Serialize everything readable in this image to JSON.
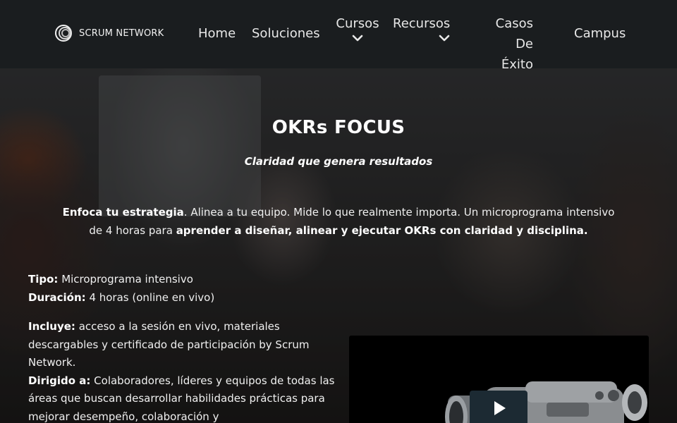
{
  "header": {
    "logo_text": "SCRUM NETWORK",
    "nav": {
      "home": "Home",
      "soluciones": "Soluciones",
      "cursos": "Cursos",
      "recursos": "Recursos",
      "casos_line1": "Casos De",
      "casos_line2": "Éxito",
      "campus": "Campus"
    }
  },
  "hero": {
    "title": "OKRs FOCUS",
    "subtitle": "Claridad que genera resultados",
    "intro": {
      "bold1": "Enfoca tu estrategia",
      "text1": ". Alinea a tu equipo. Mide lo que realmente importa. Un microprograma intensivo de 4 horas para ",
      "bold2": "aprender a diseñar, alinear y ejecutar OKRs con claridad y disciplina."
    }
  },
  "details": {
    "tipo_label": "Tipo:",
    "tipo_value": " Microprograma intensivo",
    "duracion_label": "Duración:",
    "duracion_value": " 4 horas (online en vivo)",
    "incluye_label": "Incluye:",
    "incluye_value": " acceso a la sesión en vivo, materiales descargables y certificado de participación by Scrum Network.",
    "dirigido_label": "Dirigido a:",
    "dirigido_value": " Colaboradores, líderes y equipos de todas las áreas que buscan desarrollar habilidades prácticas para mejorar desempeño, colaboración y"
  },
  "video": {
    "play_icon": "play-icon"
  },
  "colors": {
    "header_bg": "#1a1d1f",
    "play_button_bg": "#1c2a33",
    "text": "#ffffff"
  }
}
